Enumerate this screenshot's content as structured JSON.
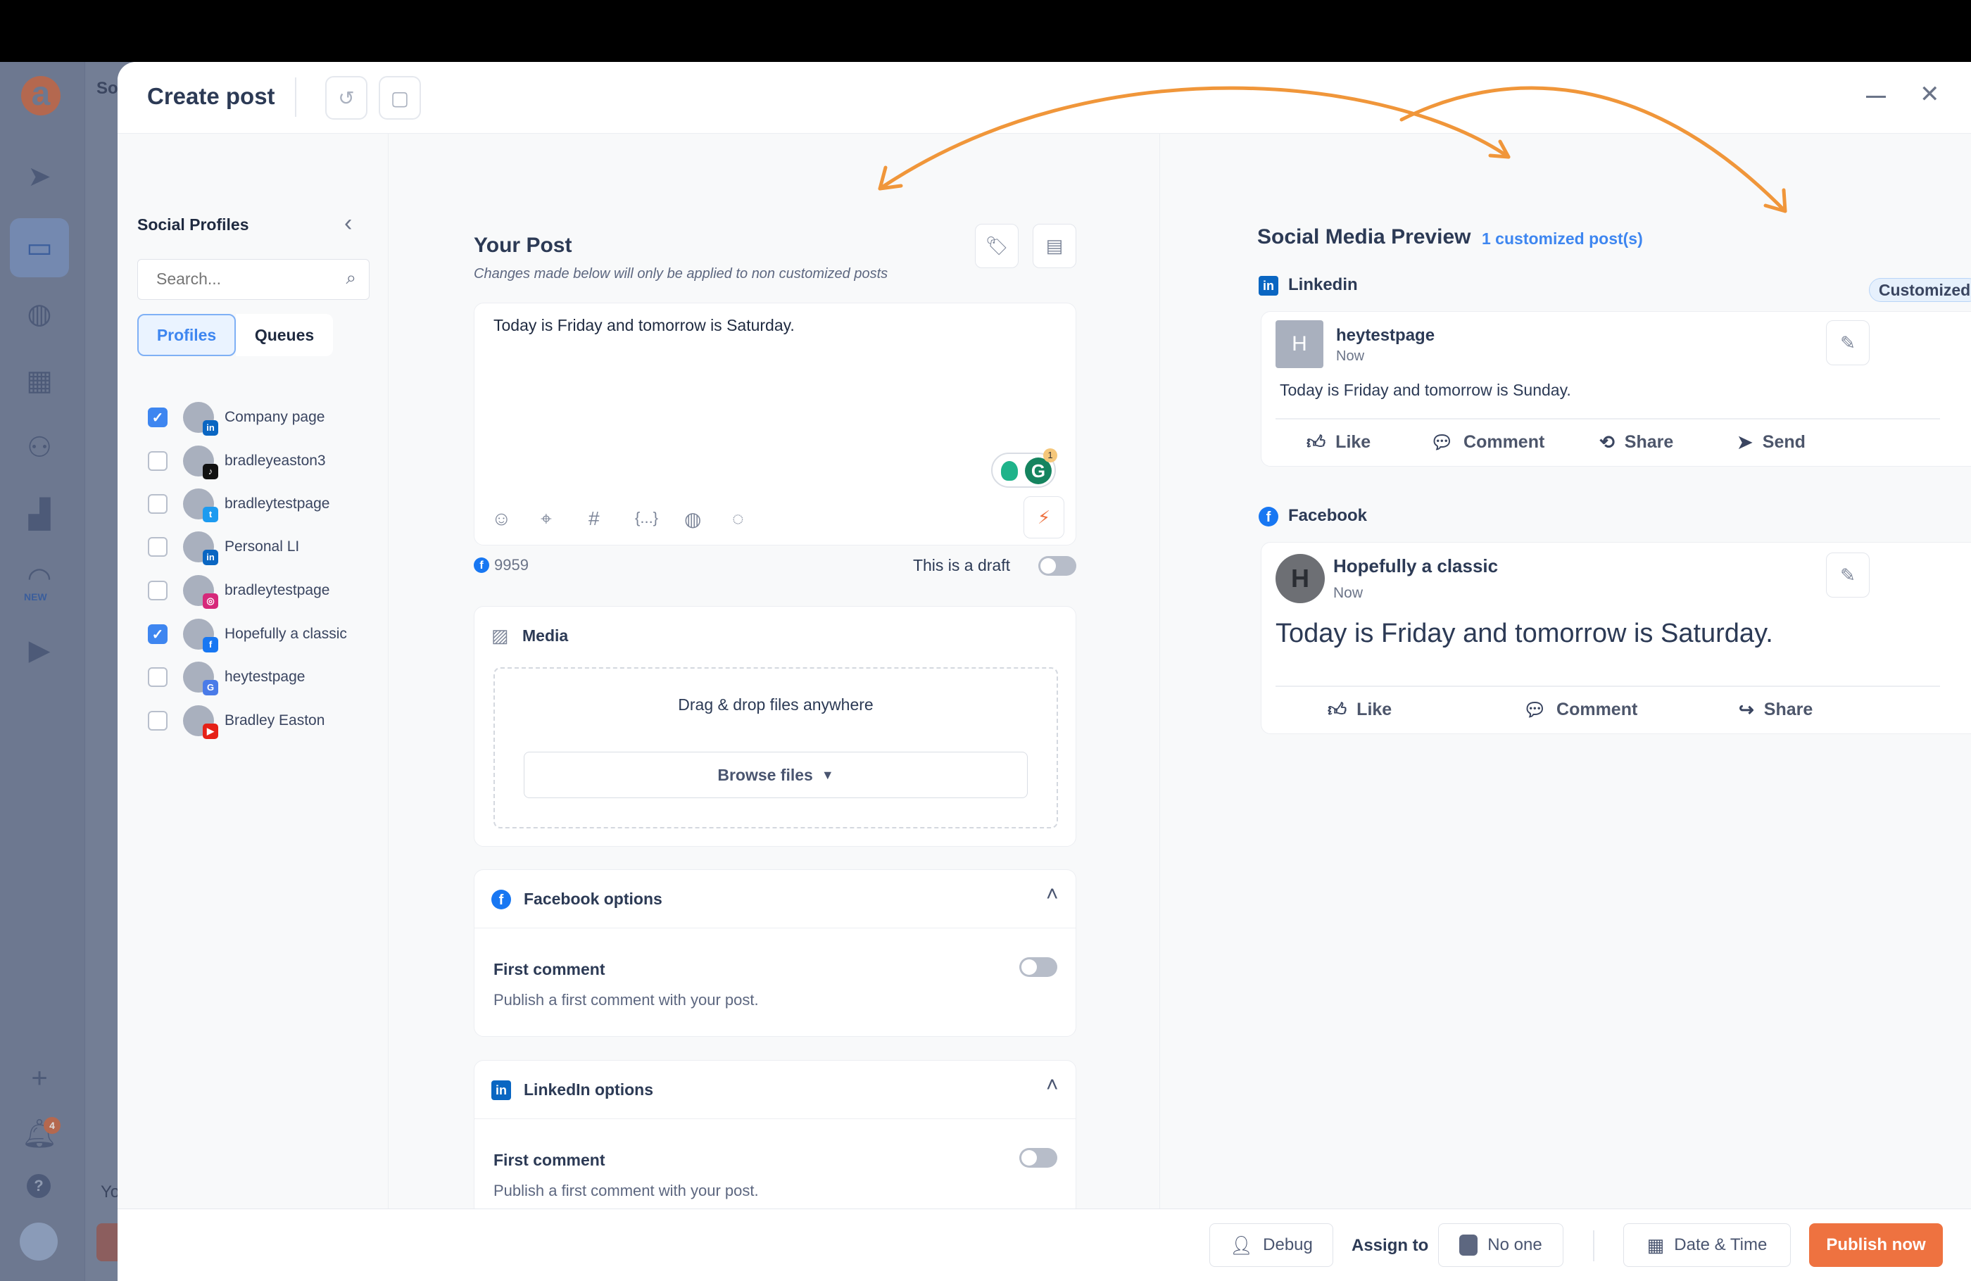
{
  "background": {
    "notification_count": "4",
    "new_label": "NEW",
    "peek_text_top": "So",
    "peek_text_bottom": "Yo"
  },
  "header": {
    "title": "Create post"
  },
  "profiles_panel": {
    "title": "Social Profiles",
    "search_placeholder": "Search...",
    "tabs": [
      {
        "label": "Profiles",
        "active": true
      },
      {
        "label": "Queues",
        "active": false
      }
    ],
    "items": [
      {
        "name": "Company page",
        "network": "linkedin",
        "checked": true
      },
      {
        "name": "bradleyeaston3",
        "network": "tiktok",
        "checked": false
      },
      {
        "name": "bradleytestpage",
        "network": "twitter",
        "checked": false
      },
      {
        "name": "Personal LI",
        "network": "linkedin",
        "checked": false
      },
      {
        "name": "bradleytestpage",
        "network": "instagram",
        "checked": false
      },
      {
        "name": "Hopefully a classic",
        "network": "facebook",
        "checked": true
      },
      {
        "name": "heytestpage",
        "network": "google-business",
        "checked": false
      },
      {
        "name": "Bradley Easton",
        "network": "youtube",
        "checked": false
      }
    ]
  },
  "post": {
    "title": "Your Post",
    "subtitle": "Changes made below will only be applied to non customized posts",
    "text": "Today is Friday and tomorrow is Saturday.",
    "grammarly_count": "1",
    "char_count": "9959",
    "draft_label": "This is a draft",
    "draft_on": false
  },
  "media": {
    "title": "Media",
    "drop_text": "Drag & drop files anywhere",
    "browse_label": "Browse files"
  },
  "facebook_options": {
    "title": "Facebook options",
    "first_comment_label": "First comment",
    "first_comment_desc": "Publish a first comment with your post.",
    "enabled": false
  },
  "linkedin_options": {
    "title": "LinkedIn options",
    "first_comment_label": "First comment",
    "first_comment_desc": "Publish a first comment with your post.",
    "enabled": false
  },
  "preview": {
    "title": "Social Media Preview",
    "customized_link": "1 customized post(s)",
    "linkedin": {
      "network": "Linkedin",
      "badge": "Customized",
      "avatar_letter": "H",
      "name": "heytestpage",
      "time": "Now",
      "text": "Today is Friday and tomorrow is Sunday.",
      "actions": [
        "Like",
        "Comment",
        "Share",
        "Send"
      ]
    },
    "facebook": {
      "network": "Facebook",
      "avatar_letter": "H",
      "name": "Hopefully a classic",
      "time": "Now",
      "text": "Today is Friday and tomorrow is Saturday.",
      "actions": [
        "Like",
        "Comment",
        "Share"
      ]
    }
  },
  "footer": {
    "debug_label": "Debug",
    "assign_label": "Assign to",
    "assignee": "No one",
    "datetime_label": "Date & Time",
    "publish_label": "Publish now"
  },
  "colors": {
    "accent": "#3e86f0",
    "publish": "#ee7240",
    "annotation_arrow": "#f0963a",
    "linkedin": "#0a66c2",
    "facebook": "#1877f2"
  }
}
